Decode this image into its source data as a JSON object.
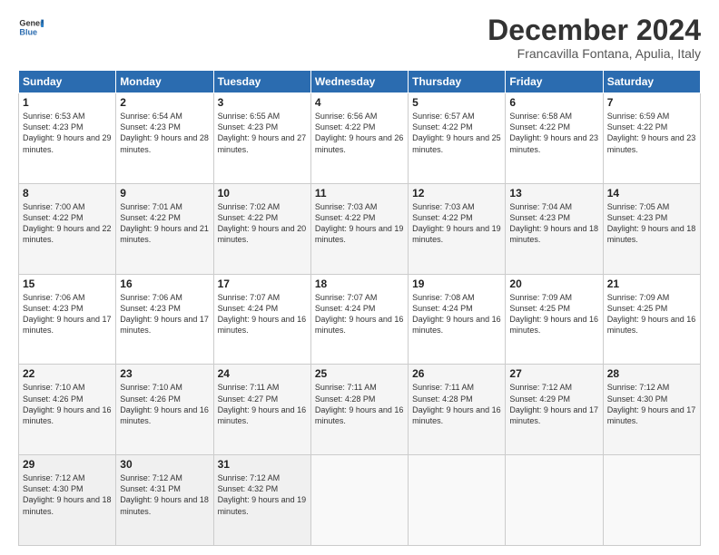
{
  "logo": {
    "line1": "General",
    "line2": "Blue"
  },
  "title": "December 2024",
  "location": "Francavilla Fontana, Apulia, Italy",
  "days_of_week": [
    "Sunday",
    "Monday",
    "Tuesday",
    "Wednesday",
    "Thursday",
    "Friday",
    "Saturday"
  ],
  "weeks": [
    [
      {
        "day": "1",
        "sunrise": "6:53 AM",
        "sunset": "4:23 PM",
        "daylight": "9 hours and 29 minutes."
      },
      {
        "day": "2",
        "sunrise": "6:54 AM",
        "sunset": "4:23 PM",
        "daylight": "9 hours and 28 minutes."
      },
      {
        "day": "3",
        "sunrise": "6:55 AM",
        "sunset": "4:23 PM",
        "daylight": "9 hours and 27 minutes."
      },
      {
        "day": "4",
        "sunrise": "6:56 AM",
        "sunset": "4:22 PM",
        "daylight": "9 hours and 26 minutes."
      },
      {
        "day": "5",
        "sunrise": "6:57 AM",
        "sunset": "4:22 PM",
        "daylight": "9 hours and 25 minutes."
      },
      {
        "day": "6",
        "sunrise": "6:58 AM",
        "sunset": "4:22 PM",
        "daylight": "9 hours and 23 minutes."
      },
      {
        "day": "7",
        "sunrise": "6:59 AM",
        "sunset": "4:22 PM",
        "daylight": "9 hours and 23 minutes."
      }
    ],
    [
      {
        "day": "8",
        "sunrise": "7:00 AM",
        "sunset": "4:22 PM",
        "daylight": "9 hours and 22 minutes."
      },
      {
        "day": "9",
        "sunrise": "7:01 AM",
        "sunset": "4:22 PM",
        "daylight": "9 hours and 21 minutes."
      },
      {
        "day": "10",
        "sunrise": "7:02 AM",
        "sunset": "4:22 PM",
        "daylight": "9 hours and 20 minutes."
      },
      {
        "day": "11",
        "sunrise": "7:03 AM",
        "sunset": "4:22 PM",
        "daylight": "9 hours and 19 minutes."
      },
      {
        "day": "12",
        "sunrise": "7:03 AM",
        "sunset": "4:22 PM",
        "daylight": "9 hours and 19 minutes."
      },
      {
        "day": "13",
        "sunrise": "7:04 AM",
        "sunset": "4:23 PM",
        "daylight": "9 hours and 18 minutes."
      },
      {
        "day": "14",
        "sunrise": "7:05 AM",
        "sunset": "4:23 PM",
        "daylight": "9 hours and 18 minutes."
      }
    ],
    [
      {
        "day": "15",
        "sunrise": "7:06 AM",
        "sunset": "4:23 PM",
        "daylight": "9 hours and 17 minutes."
      },
      {
        "day": "16",
        "sunrise": "7:06 AM",
        "sunset": "4:23 PM",
        "daylight": "9 hours and 17 minutes."
      },
      {
        "day": "17",
        "sunrise": "7:07 AM",
        "sunset": "4:24 PM",
        "daylight": "9 hours and 16 minutes."
      },
      {
        "day": "18",
        "sunrise": "7:07 AM",
        "sunset": "4:24 PM",
        "daylight": "9 hours and 16 minutes."
      },
      {
        "day": "19",
        "sunrise": "7:08 AM",
        "sunset": "4:24 PM",
        "daylight": "9 hours and 16 minutes."
      },
      {
        "day": "20",
        "sunrise": "7:09 AM",
        "sunset": "4:25 PM",
        "daylight": "9 hours and 16 minutes."
      },
      {
        "day": "21",
        "sunrise": "7:09 AM",
        "sunset": "4:25 PM",
        "daylight": "9 hours and 16 minutes."
      }
    ],
    [
      {
        "day": "22",
        "sunrise": "7:10 AM",
        "sunset": "4:26 PM",
        "daylight": "9 hours and 16 minutes."
      },
      {
        "day": "23",
        "sunrise": "7:10 AM",
        "sunset": "4:26 PM",
        "daylight": "9 hours and 16 minutes."
      },
      {
        "day": "24",
        "sunrise": "7:11 AM",
        "sunset": "4:27 PM",
        "daylight": "9 hours and 16 minutes."
      },
      {
        "day": "25",
        "sunrise": "7:11 AM",
        "sunset": "4:28 PM",
        "daylight": "9 hours and 16 minutes."
      },
      {
        "day": "26",
        "sunrise": "7:11 AM",
        "sunset": "4:28 PM",
        "daylight": "9 hours and 16 minutes."
      },
      {
        "day": "27",
        "sunrise": "7:12 AM",
        "sunset": "4:29 PM",
        "daylight": "9 hours and 17 minutes."
      },
      {
        "day": "28",
        "sunrise": "7:12 AM",
        "sunset": "4:30 PM",
        "daylight": "9 hours and 17 minutes."
      }
    ],
    [
      {
        "day": "29",
        "sunrise": "7:12 AM",
        "sunset": "4:30 PM",
        "daylight": "9 hours and 18 minutes."
      },
      {
        "day": "30",
        "sunrise": "7:12 AM",
        "sunset": "4:31 PM",
        "daylight": "9 hours and 18 minutes."
      },
      {
        "day": "31",
        "sunrise": "7:12 AM",
        "sunset": "4:32 PM",
        "daylight": "9 hours and 19 minutes."
      },
      null,
      null,
      null,
      null
    ]
  ],
  "labels": {
    "sunrise": "Sunrise:",
    "sunset": "Sunset:",
    "daylight": "Daylight:"
  }
}
